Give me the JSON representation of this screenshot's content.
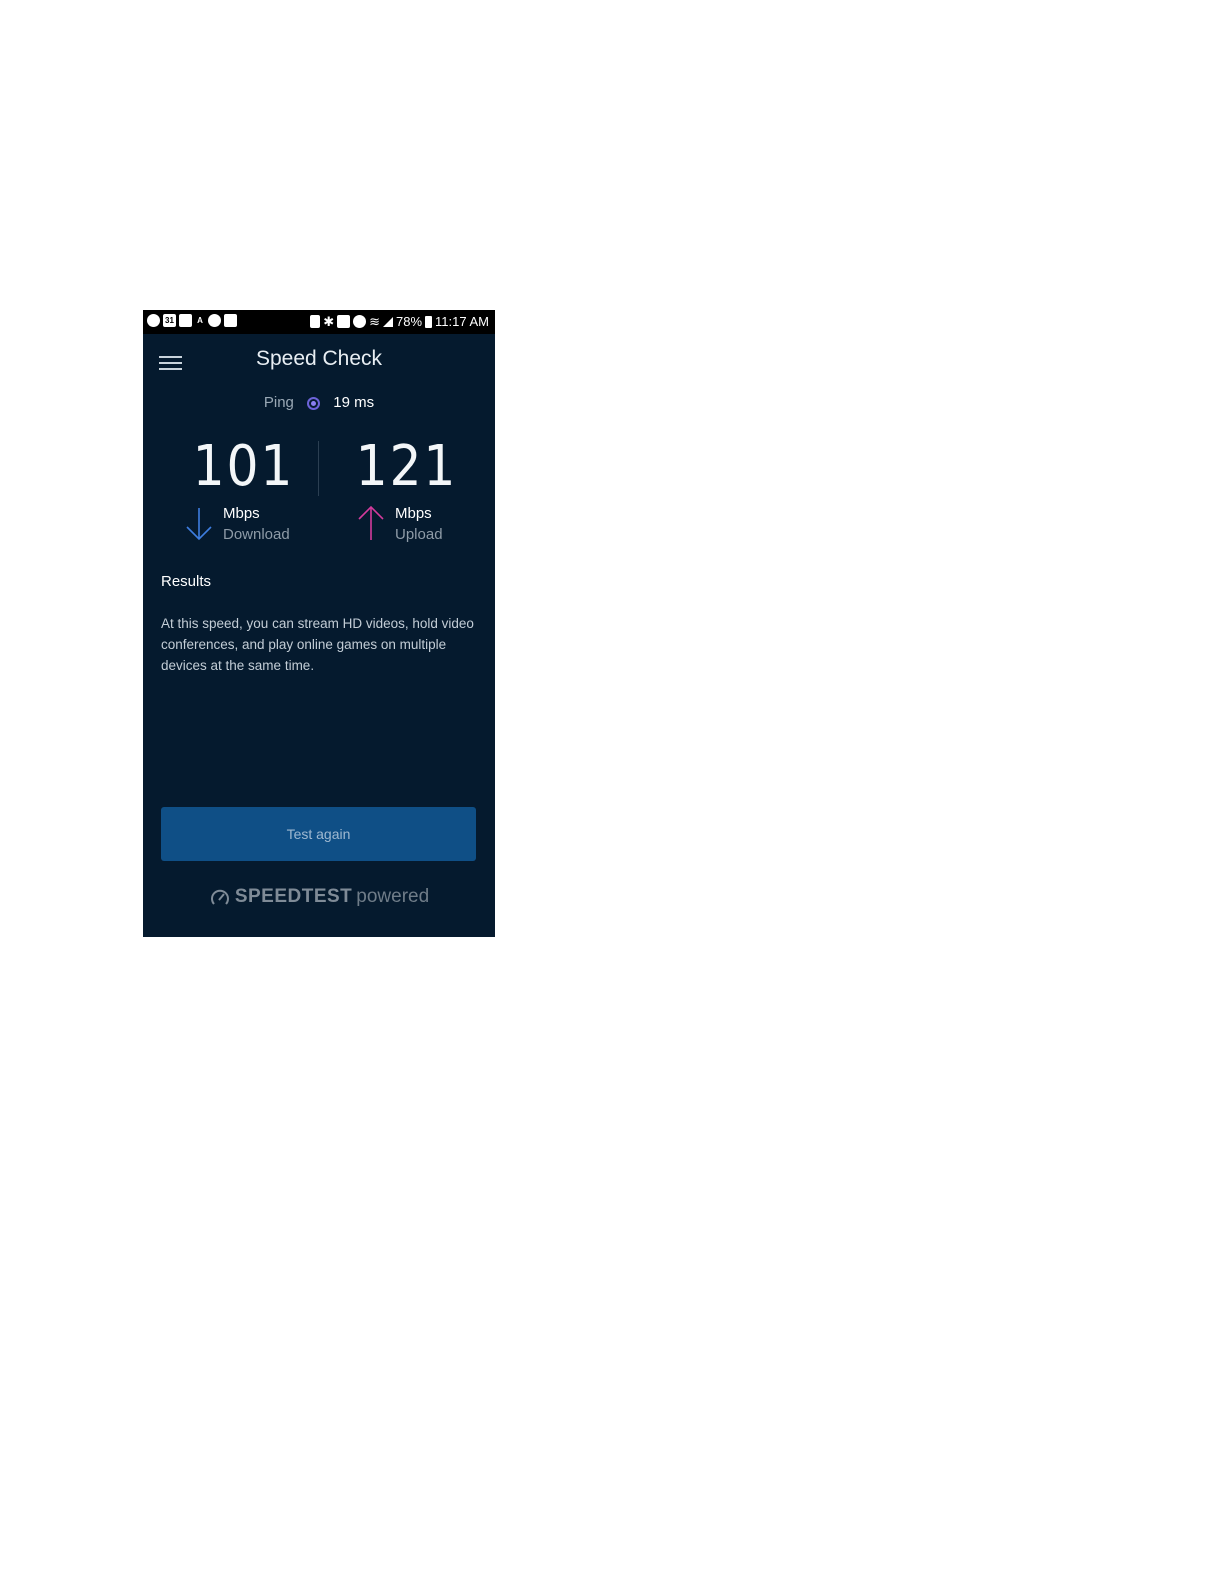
{
  "status_bar": {
    "battery": "78%",
    "time": "11:17 AM",
    "left_icons": [
      "app-icon",
      "calendar-icon",
      "outlook-icon",
      "translate-icon",
      "spotify-icon",
      "mail-icon"
    ],
    "right_icons": [
      "lock-icon",
      "bluetooth-icon",
      "nfc-icon",
      "alarm-icon",
      "wifi-icon",
      "signal-icon",
      "battery-icon"
    ],
    "calendar_day": "31"
  },
  "header": {
    "title": "Speed Check",
    "menu_icon": "hamburger-icon"
  },
  "ping": {
    "label": "Ping",
    "value": "19 ms",
    "dot_color": "#6c63d8"
  },
  "download": {
    "value": "101",
    "unit": "Mbps",
    "label": "Download",
    "arrow_color": "#3d7de0"
  },
  "upload": {
    "value": "121",
    "unit": "Mbps",
    "label": "Upload",
    "arrow_color": "#d43b9c"
  },
  "results": {
    "title": "Results",
    "text": "At this speed, you can stream HD videos, hold video conferences, and play online games on multiple devices at the same time."
  },
  "test_button": {
    "label": "Test again"
  },
  "footer": {
    "brand": "SPEEDTEST",
    "suffix": "powered",
    "icon": "speedometer-icon"
  }
}
